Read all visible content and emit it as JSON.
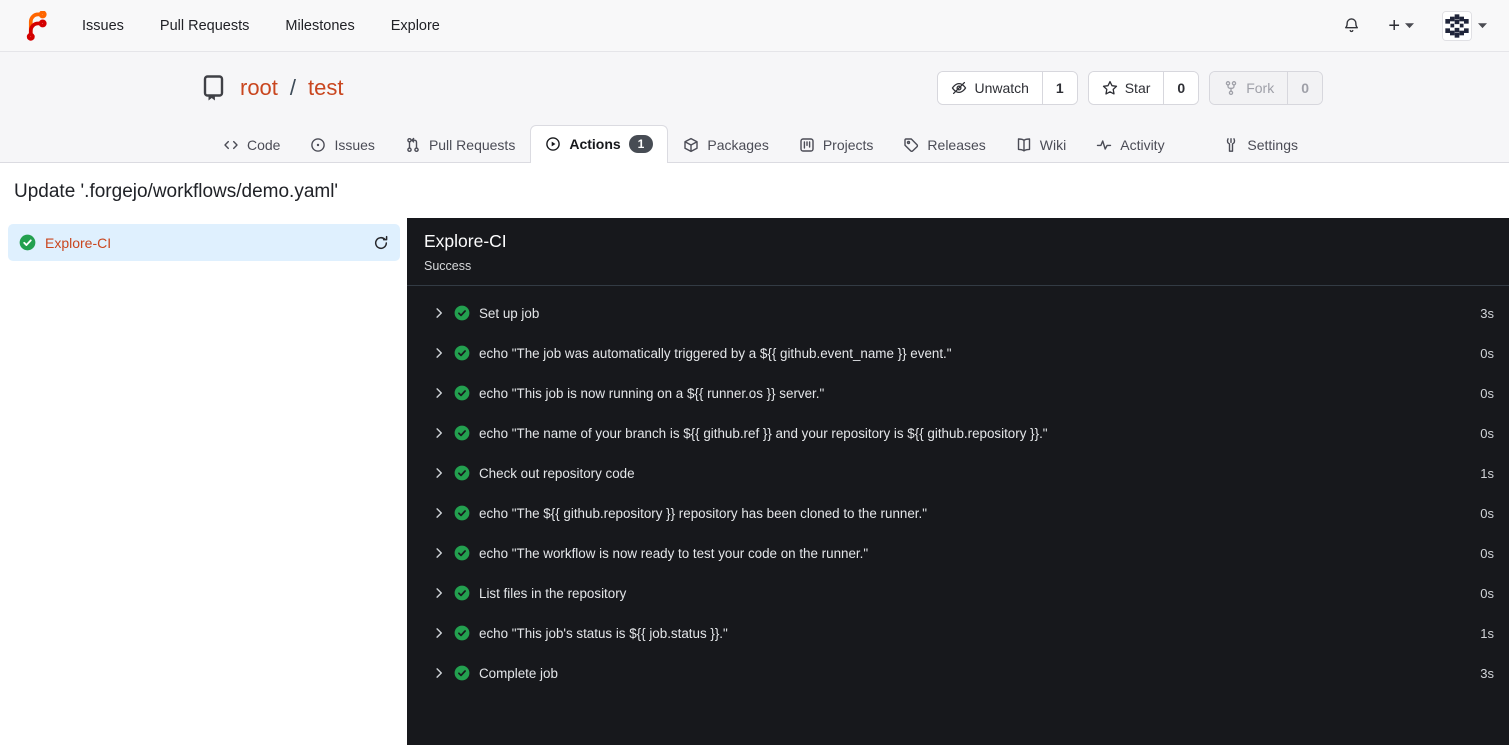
{
  "navbar": {
    "links": [
      {
        "label": "Issues"
      },
      {
        "label": "Pull Requests"
      },
      {
        "label": "Milestones"
      },
      {
        "label": "Explore"
      }
    ],
    "create_label": "+"
  },
  "repo_header": {
    "owner": "root",
    "separator": "/",
    "name": "test",
    "actions": {
      "unwatch": {
        "label": "Unwatch",
        "count": "1"
      },
      "star": {
        "label": "Star",
        "count": "0"
      },
      "fork": {
        "label": "Fork",
        "count": "0",
        "disabled": true
      }
    }
  },
  "tabs": [
    {
      "label": "Code"
    },
    {
      "label": "Issues"
    },
    {
      "label": "Pull Requests"
    },
    {
      "label": "Actions",
      "badge": "1",
      "active": true
    },
    {
      "label": "Packages"
    },
    {
      "label": "Projects"
    },
    {
      "label": "Releases"
    },
    {
      "label": "Wiki"
    },
    {
      "label": "Activity"
    },
    {
      "label": "Settings"
    }
  ],
  "page": {
    "title": "Update '.forgejo/workflows/demo.yaml'"
  },
  "sidebar": {
    "jobs": [
      {
        "name": "Explore-CI",
        "status": "success",
        "selected": true
      }
    ]
  },
  "job_panel": {
    "title": "Explore-CI",
    "status": "Success",
    "steps": [
      {
        "name": "Set up job",
        "duration": "3s"
      },
      {
        "name": "echo \"The job was automatically triggered by a ${{ github.event_name }} event.\"",
        "duration": "0s"
      },
      {
        "name": "echo \"This job is now running on a ${{ runner.os }} server.\"",
        "duration": "0s"
      },
      {
        "name": "echo \"The name of your branch is ${{ github.ref }} and your repository is ${{ github.repository }}.\"",
        "duration": "0s"
      },
      {
        "name": "Check out repository code",
        "duration": "1s"
      },
      {
        "name": "echo \"The ${{ github.repository }} repository has been cloned to the runner.\"",
        "duration": "0s"
      },
      {
        "name": "echo \"The workflow is now ready to test your code on the runner.\"",
        "duration": "0s"
      },
      {
        "name": "List files in the repository",
        "duration": "0s"
      },
      {
        "name": "echo \"This job's status is ${{ job.status }}.\"",
        "duration": "1s"
      },
      {
        "name": "Complete job",
        "duration": "3s"
      }
    ]
  },
  "colors": {
    "accent_link": "#c9461f",
    "success_green": "#23a04f",
    "panel_bg": "#17181c",
    "selected_job_bg": "#dff0fe",
    "badge_bg": "#474c54",
    "logo_orange": "#ff6600",
    "logo_red": "#d40000"
  }
}
